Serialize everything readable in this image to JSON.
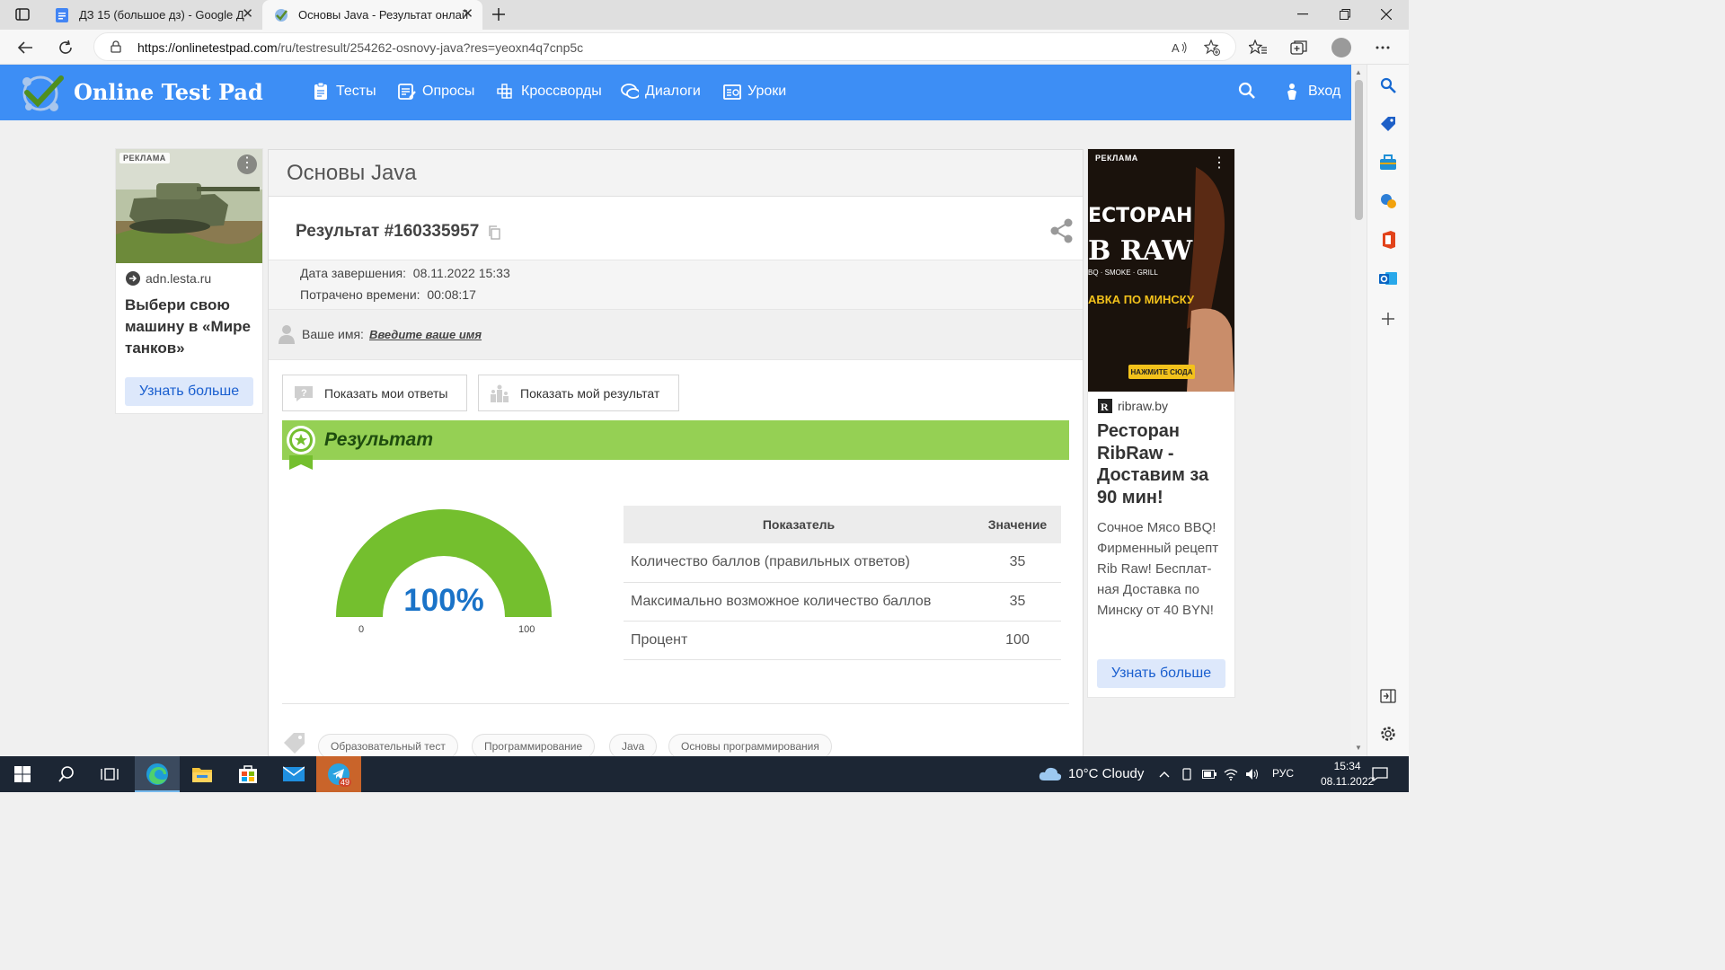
{
  "browser": {
    "tabs": [
      {
        "title": "ДЗ 15 (большое дз) - Google Д"
      },
      {
        "title": "Основы Java - Результат онлай"
      }
    ],
    "url_host": "https://onlinetestpad.com",
    "url_path": "/ru/testresult/254262-osnovy-java?res=yeoxn4q7cnp5c"
  },
  "site": {
    "logo": "Online Test Pad",
    "menu": [
      {
        "label": "Тесты",
        "icon": "tests-icon"
      },
      {
        "label": "Опросы",
        "icon": "polls-icon"
      },
      {
        "label": "Кроссворды",
        "icon": "crosswords-icon"
      },
      {
        "label": "Диалоги",
        "icon": "dialogs-icon"
      },
      {
        "label": "Уроки",
        "icon": "lessons-icon"
      }
    ],
    "login": "Вход"
  },
  "ad_left": {
    "label": "РЕКЛАМА",
    "domain": "adn.lesta.ru",
    "headline": "Выбери свою машину в «Мире танков»",
    "button": "Узнать больше"
  },
  "ad_right": {
    "label": "РЕКЛАМА",
    "image_line1": "ЕСТОРАН",
    "image_line2": "B RAW",
    "image_line3": "BQ · SMOKE · GRILL",
    "image_line4": "АВКА ПО МИНСКУ",
    "image_button": "НАЖМИТЕ СЮДА",
    "domain": "ribraw.by",
    "headline": "Ресторан RibRaw - Доставим за 90 мин!",
    "body": "Сочное Мясо BBQ! Фирменный рецепт Rib Raw! Бесплат-ная Доставка по Минску от 40 BYN!",
    "button": "Узнать больше"
  },
  "test": {
    "title": "Основы Java",
    "result_title": "Результат #160335957",
    "finish_label": "Дата завершения:",
    "finish_value": "08.11.2022 15:33",
    "spent_label": "Потрачено времени:",
    "spent_value": "00:08:17",
    "name_label": "Ваше имя:",
    "name_link": "Введите ваше имя",
    "btn_answers": "Показать мои ответы",
    "btn_result": "Показать мой результат",
    "banner": "Результат",
    "gauge": {
      "percent": 100,
      "label": "100%",
      "min": "0",
      "max": "100"
    },
    "table": {
      "headers": [
        "Показатель",
        "Значение"
      ],
      "rows": [
        [
          "Количество баллов (правильных ответов)",
          "35"
        ],
        [
          "Максимально возможное количество баллов",
          "35"
        ],
        [
          "Процент",
          "100"
        ]
      ]
    },
    "tags": [
      "Образовательный тест",
      "Программирование",
      "Java",
      "Основы программирования"
    ]
  },
  "taskbar": {
    "weather": "10°C Cloudy",
    "lang": "РУС",
    "time": "15:34",
    "date": "08.11.2022",
    "telegram_badge": "49"
  },
  "colors": {
    "header": "#3d8ef5",
    "banner": "#95d054",
    "gauge": "#74bf2e",
    "percent_text": "#1a73c8"
  }
}
